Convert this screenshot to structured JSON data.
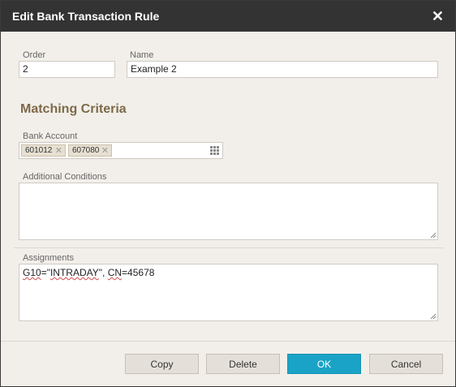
{
  "dialog": {
    "title": "Edit Bank Transaction Rule",
    "close_icon": "close-icon"
  },
  "fields": {
    "order_label": "Order",
    "order_value": "2",
    "name_label": "Name",
    "name_value": "Example 2"
  },
  "matching": {
    "section_title": "Matching Criteria",
    "bank_account_label": "Bank Account",
    "bank_accounts": [
      "601012",
      "607080"
    ],
    "tag_remove_icon": "remove-x-icon",
    "lookup_icon": "grid-lookup-icon",
    "additional_conditions_label": "Additional Conditions",
    "additional_conditions_value": ""
  },
  "assignments": {
    "label": "Assignments",
    "value_part1": "G10",
    "value_part2": "=\"",
    "value_part3": "INTRADAY",
    "value_part4": "\", ",
    "value_part5": "CN",
    "value_part6": "=45678"
  },
  "buttons": {
    "copy": "Copy",
    "delete": "Delete",
    "ok": "OK",
    "cancel": "Cancel"
  },
  "colors": {
    "titlebar": "#333333",
    "section_title": "#7d6a48",
    "ok_button": "#1aa3c6",
    "dialog_bg": "#f2efea"
  }
}
